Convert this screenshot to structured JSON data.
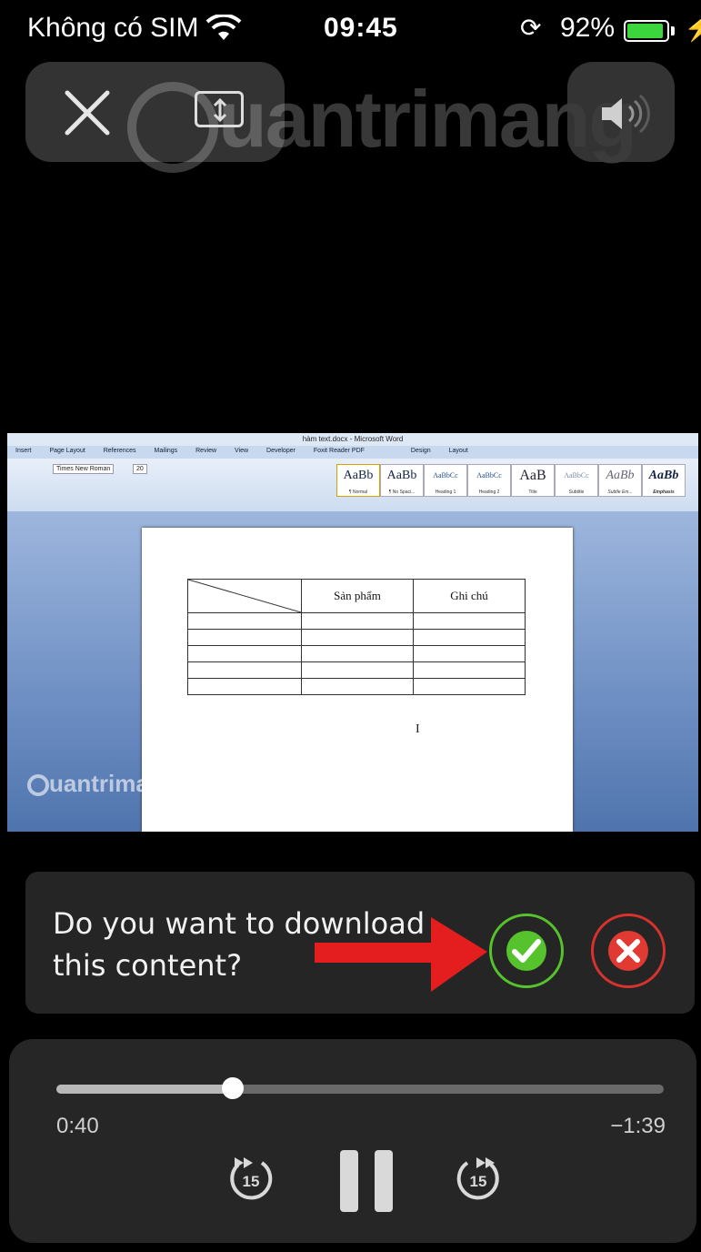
{
  "status_bar": {
    "carrier": "Không có SIM",
    "time": "09:45",
    "battery_percent": "92%",
    "battery_level": 0.92,
    "icons": [
      "wifi-icon",
      "rotation-lock-icon",
      "battery-icon",
      "charging-icon"
    ]
  },
  "player_top": {
    "icons": [
      "close-icon",
      "aspect-fit-icon",
      "volume-icon"
    ]
  },
  "watermark": {
    "text": "uantrimang",
    "video_text": "uantrimang"
  },
  "video": {
    "word_title": "hàm text.docx - Microsoft Word",
    "ribbon_tabs": [
      "Insert",
      "Page Layout",
      "References",
      "Mailings",
      "Review",
      "View",
      "Developer",
      "Foxit Reader PDF",
      "Design",
      "Layout"
    ],
    "font_name": "Times New Roman",
    "font_size": "20",
    "styles": [
      {
        "preview": "AaBb",
        "name": "¶ Normal"
      },
      {
        "preview": "AaBb",
        "name": "¶ No Spaci..."
      },
      {
        "preview": "AaBbCc",
        "name": "Heading 1"
      },
      {
        "preview": "AaBbCc",
        "name": "Heading 2"
      },
      {
        "preview": "AaB",
        "name": "Title"
      },
      {
        "preview": "AaBbCc",
        "name": "Subtitle"
      },
      {
        "preview": "AaBb",
        "name": "Subtle Em..."
      },
      {
        "preview": "AaBb",
        "name": "Emphasis"
      }
    ],
    "table_headers": [
      "",
      "Sản phẩm",
      "Ghi chú"
    ],
    "table_rows": 5
  },
  "download_prompt": {
    "text": "Do you want to download this content?",
    "confirm_icon": "check-icon",
    "cancel_icon": "x-icon",
    "accent_confirm": "#56c22c",
    "accent_cancel": "#e03a33"
  },
  "playback": {
    "elapsed": "0:40",
    "remaining": "−1:39",
    "progress": 0.29,
    "skip_back_label": "15",
    "skip_forward_label": "15",
    "icons": [
      "skip-back-15-icon",
      "pause-icon",
      "skip-forward-15-icon"
    ]
  }
}
